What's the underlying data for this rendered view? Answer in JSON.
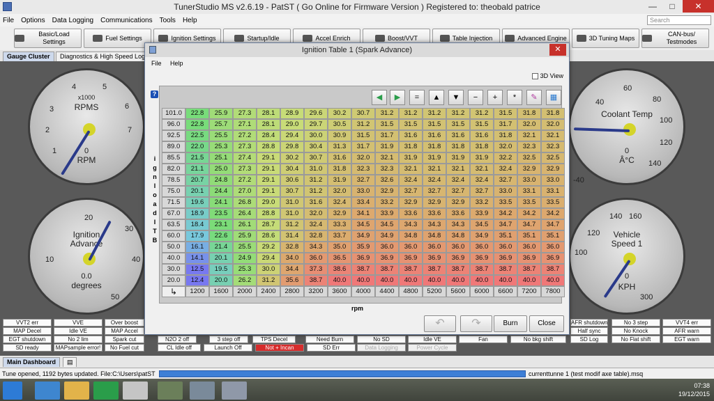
{
  "app": {
    "title": "TunerStudio MS v2.6.19 - PatST ( Go Online for Firmware Version ) Registered to: theobald patrice",
    "window_buttons": {
      "minimize": "—",
      "maximize": "□",
      "close": "✕"
    }
  },
  "menu": [
    "File",
    "Options",
    "Data Logging",
    "Communications",
    "Tools",
    "Help"
  ],
  "search": {
    "placeholder": "Search"
  },
  "toolbar": [
    "Basic/Load Settings",
    "Fuel Settings",
    "Ignition Settings",
    "Startup/Idle",
    "Accel Enrich",
    "Boost/VVT",
    "Table Injection",
    "Advanced Engine",
    "3D Tuning Maps",
    "CAN-bus/ Testmodes"
  ],
  "tabs_top": [
    "Gauge Cluster",
    "Diagnostics & High Speed Loggers"
  ],
  "gauges": {
    "rpm": {
      "label": "RPMS",
      "sublabel": "x1000",
      "value": "0",
      "unit": "RPM",
      "ticks": [
        "1",
        "2",
        "3",
        "4",
        "5",
        "6",
        "7"
      ]
    },
    "advance": {
      "label": "Ignition Advance",
      "value": "0.0",
      "unit": "degrees",
      "ticks": [
        "10",
        "20",
        "30",
        "40",
        "50"
      ]
    },
    "coolant": {
      "label": "Coolant Temp",
      "value": "0",
      "unit": "Â°C",
      "ticks": [
        "40",
        "60",
        "80",
        "100",
        "120",
        "140",
        "-40"
      ]
    },
    "speed": {
      "label": "Vehicle Speed 1",
      "value": "0",
      "unit": "KPH",
      "ticks": [
        "140",
        "160",
        "120",
        "100",
        "300"
      ]
    }
  },
  "indicators_left": [
    [
      "VVT2 err",
      "VVE",
      "Over boost"
    ],
    [
      "MAP Decel",
      "Idle VE",
      "MAP Accel"
    ],
    [
      "EGT shutdown",
      "No 2 lim",
      "Spark cut"
    ],
    [
      "SD ready",
      "MAPsample error!",
      "No Fuel cut"
    ]
  ],
  "indicators_mid": [
    [
      "N2O 2 off",
      "3 step off",
      "TPS Decel",
      "Need Burn",
      "No SD",
      "Idle VE"
    ],
    [
      "CL Idle off",
      "Launch Off",
      "Not + Incan",
      "SD Err",
      "Data Logging",
      "Power Cycle"
    ]
  ],
  "indicators_right": [
    [
      "AFR shutdown",
      "No 3 step",
      "VVT4 err"
    ],
    [
      "Half sync",
      "No Knock",
      "AFR warn"
    ],
    [
      "SD Log",
      "No Flat shift",
      "EGT warn"
    ],
    [
      "Fan",
      "No bkg shift",
      ""
    ]
  ],
  "tabs_bottom": [
    "Main Dashboard"
  ],
  "status": {
    "message": "Tune opened, 1192 bytes updated. File:C:\\Users\\patST",
    "tune_file": "currenttunne 1 (test modif axe table).msq"
  },
  "taskbar": {
    "time": "07:38",
    "date": "19/12/2015"
  },
  "dialog": {
    "title": "Ignition Table 1 (Spark Advance)",
    "menu": [
      "File",
      "Help"
    ],
    "view3d": "3D View",
    "yaxis_label": "i g n l o a d I T B",
    "xaxis_label": "rpm",
    "tools": [
      "◀",
      "▶",
      "=",
      "▲",
      "▼",
      "−",
      "+",
      "*",
      "✎",
      "▦"
    ],
    "footer": {
      "undo": "↶",
      "redo": "↷",
      "burn": "Burn",
      "close": "Close"
    },
    "table": {
      "y_axis": [
        "101.0",
        "96.0",
        "92.5",
        "89.0",
        "85.5",
        "82.0",
        "78.5",
        "75.0",
        "71.5",
        "67.0",
        "63.5",
        "60.0",
        "50.0",
        "40.0",
        "30.0",
        "20.0"
      ],
      "x_axis": [
        "1200",
        "1600",
        "2000",
        "2400",
        "2800",
        "3200",
        "3600",
        "4000",
        "4400",
        "4800",
        "5200",
        "5600",
        "6000",
        "6600",
        "7200",
        "7800"
      ],
      "rows": [
        [
          "22.8",
          "25.9",
          "27.3",
          "28.1",
          "28.9",
          "29.6",
          "30.2",
          "30.7",
          "31.2",
          "31.2",
          "31.2",
          "31.2",
          "31.2",
          "31.5",
          "31.8",
          "31.8"
        ],
        [
          "22.8",
          "25.7",
          "27.1",
          "28.1",
          "29.0",
          "29.7",
          "30.5",
          "31.2",
          "31.5",
          "31.5",
          "31.5",
          "31.5",
          "31.5",
          "31.7",
          "32.0",
          "32.0"
        ],
        [
          "22.5",
          "25.5",
          "27.2",
          "28.4",
          "29.4",
          "30.0",
          "30.9",
          "31.5",
          "31.7",
          "31.6",
          "31.6",
          "31.6",
          "31.6",
          "31.8",
          "32.1",
          "32.1"
        ],
        [
          "22.0",
          "25.3",
          "27.3",
          "28.8",
          "29.8",
          "30.4",
          "31.3",
          "31.7",
          "31.9",
          "31.8",
          "31.8",
          "31.8",
          "31.8",
          "32.0",
          "32.3",
          "32.3"
        ],
        [
          "21.5",
          "25.1",
          "27.4",
          "29.1",
          "30.2",
          "30.7",
          "31.6",
          "32.0",
          "32.1",
          "31.9",
          "31.9",
          "31.9",
          "31.9",
          "32.2",
          "32.5",
          "32.5"
        ],
        [
          "21.1",
          "25.0",
          "27.3",
          "29.1",
          "30.4",
          "31.0",
          "31.8",
          "32.3",
          "32.3",
          "32.1",
          "32.1",
          "32.1",
          "32.1",
          "32.4",
          "32.9",
          "32.9"
        ],
        [
          "20.7",
          "24.8",
          "27.2",
          "29.1",
          "30.6",
          "31.2",
          "31.9",
          "32.7",
          "32.6",
          "32.4",
          "32.4",
          "32.4",
          "32.4",
          "32.7",
          "33.0",
          "33.0"
        ],
        [
          "20.1",
          "24.4",
          "27.0",
          "29.1",
          "30.7",
          "31.2",
          "32.0",
          "33.0",
          "32.9",
          "32.7",
          "32.7",
          "32.7",
          "32.7",
          "33.0",
          "33.1",
          "33.1"
        ],
        [
          "19.6",
          "24.1",
          "26.8",
          "29.0",
          "31.0",
          "31.6",
          "32.4",
          "33.4",
          "33.2",
          "32.9",
          "32.9",
          "32.9",
          "33.2",
          "33.5",
          "33.5",
          "33.5"
        ],
        [
          "18.9",
          "23.5",
          "26.4",
          "28.8",
          "31.0",
          "32.0",
          "32.9",
          "34.1",
          "33.9",
          "33.6",
          "33.6",
          "33.6",
          "33.9",
          "34.2",
          "34.2",
          "34.2"
        ],
        [
          "18.4",
          "23.1",
          "26.1",
          "28.7",
          "31.2",
          "32.4",
          "33.3",
          "34.5",
          "34.5",
          "34.3",
          "34.3",
          "34.3",
          "34.5",
          "34.7",
          "34.7",
          "34.7"
        ],
        [
          "17.9",
          "22.6",
          "25.9",
          "28.6",
          "31.4",
          "32.8",
          "33.7",
          "34.9",
          "34.9",
          "34.8",
          "34.8",
          "34.8",
          "34.9",
          "35.1",
          "35.1",
          "35.1"
        ],
        [
          "16.1",
          "21.4",
          "25.5",
          "29.2",
          "32.8",
          "34.3",
          "35.0",
          "35.9",
          "36.0",
          "36.0",
          "36.0",
          "36.0",
          "36.0",
          "36.0",
          "36.0",
          "36.0"
        ],
        [
          "14.1",
          "20.1",
          "24.9",
          "29.4",
          "34.0",
          "36.0",
          "36.5",
          "36.9",
          "36.9",
          "36.9",
          "36.9",
          "36.9",
          "36.9",
          "36.9",
          "36.9",
          "36.9"
        ],
        [
          "12.5",
          "19.5",
          "25.3",
          "30.0",
          "34.4",
          "37.3",
          "38.6",
          "38.7",
          "38.7",
          "38.7",
          "38.7",
          "38.7",
          "38.7",
          "38.7",
          "38.7",
          "38.7"
        ],
        [
          "12.4",
          "20.0",
          "26.2",
          "31.2",
          "35.6",
          "38.7",
          "40.0",
          "40.0",
          "40.0",
          "40.0",
          "40.0",
          "40.0",
          "40.0",
          "40.0",
          "40.0",
          "40.0"
        ]
      ]
    }
  }
}
